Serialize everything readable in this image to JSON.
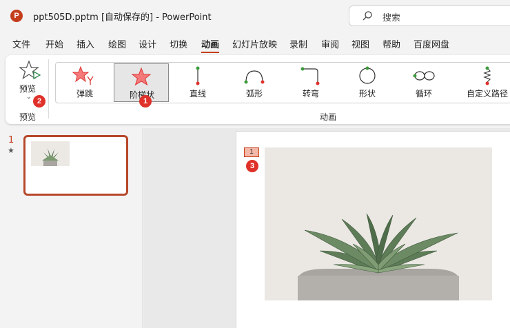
{
  "titlebar": {
    "app_icon": "P",
    "title": "ppt505D.pptm [自动保存的]  -  PowerPoint",
    "search_placeholder": "搜索"
  },
  "tabs": [
    "文件",
    "开始",
    "插入",
    "绘图",
    "设计",
    "切换",
    "动画",
    "幻灯片放映",
    "录制",
    "审阅",
    "视图",
    "帮助",
    "百度网盘"
  ],
  "active_tab": "动画",
  "ribbon": {
    "preview_label": "预览",
    "preview_group_label": "预览",
    "animations_group_label": "动画",
    "animations": [
      {
        "label": "弹跳",
        "icon": "bounce-star-icon"
      },
      {
        "label": "阶梯状",
        "icon": "staircase-star-icon",
        "selected": true
      },
      {
        "label": "直线",
        "icon": "line-path-icon"
      },
      {
        "label": "弧形",
        "icon": "arc-path-icon"
      },
      {
        "label": "转弯",
        "icon": "turn-path-icon"
      },
      {
        "label": "形状",
        "icon": "shape-path-icon"
      },
      {
        "label": "循环",
        "icon": "loop-path-icon"
      },
      {
        "label": "自定义路径",
        "icon": "custom-path-icon"
      }
    ]
  },
  "badges": {
    "one": "1",
    "two": "2",
    "three": "3"
  },
  "slides_panel": {
    "slide_number": "1",
    "has_animation_star": "★"
  },
  "slide": {
    "animation_tag": "1"
  },
  "colors": {
    "accent": "#c43e1c",
    "badge": "#e0302a",
    "path_start": "#3c9a3c",
    "path_end": "#e0302a"
  }
}
